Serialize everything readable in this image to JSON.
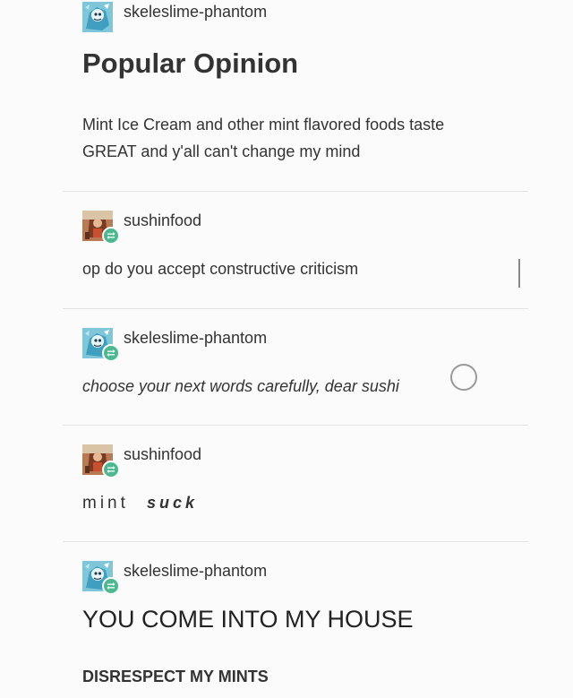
{
  "thread": {
    "post1": {
      "username": "skeleslime-phantom",
      "title": "Popular Opinion",
      "body": "Mint Ice Cream and other mint flavored foods taste GREAT and y'all can't change my mind",
      "body_line1": "Mint Ice Cream and other mint flavored foods taste",
      "body_line2": "GREAT and y'all can't change my mind"
    },
    "reply1": {
      "username": "sushinfood",
      "text": "op do you accept constructive criticism"
    },
    "reply2": {
      "username": "skeleslime-phantom",
      "text": "choose your next words carefully, dear sushi"
    },
    "reply3": {
      "username": "sushinfood",
      "word1": "mint",
      "word2": "suck"
    },
    "reply4": {
      "username": "skeleslime-phantom",
      "line1": "YOU COME INTO MY HOUSE",
      "line2": "DISRESPECT MY MINTS"
    }
  },
  "colors": {
    "background": "#fbfbfb",
    "reblog_badge": "#4bb890",
    "text": "#333333",
    "divider": "#e3e3e3"
  },
  "icons": {
    "skeleslime_avatar": "skeleslime-avatar-icon",
    "sushinfood_avatar": "sushinfood-avatar-icon",
    "reblog": "reblog-icon"
  }
}
